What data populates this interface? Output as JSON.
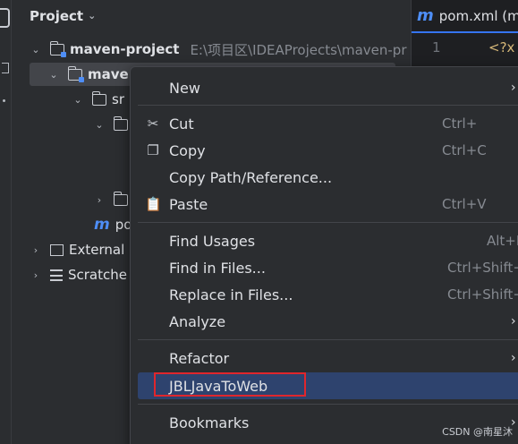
{
  "project_panel": {
    "title": "Project",
    "tree": {
      "root_name": "maven-project",
      "root_path": "E:\\项目区\\IDEAProjects\\maven-pr",
      "module_name": "mave",
      "src": "sr",
      "pom": "po",
      "external": "External",
      "scratches": "Scratche"
    }
  },
  "editor": {
    "tab_label": "pom.xml (ma",
    "line_number": "1",
    "code_text": "<?x"
  },
  "context_menu": {
    "items": [
      {
        "label": "New",
        "shortcut": "",
        "submenu": true
      },
      {
        "label": "Cut",
        "shortcut": "Ctrl+",
        "icon": "scissors-icon"
      },
      {
        "label": "Copy",
        "shortcut": "Ctrl+C",
        "icon": "copy-icon"
      },
      {
        "label": "Copy Path/Reference...",
        "shortcut": ""
      },
      {
        "label": "Paste",
        "shortcut": "Ctrl+V",
        "icon": "paste-icon"
      },
      {
        "label": "Find Usages",
        "shortcut": "Alt+F"
      },
      {
        "label": "Find in Files...",
        "shortcut": "Ctrl+Shift+"
      },
      {
        "label": "Replace in Files...",
        "shortcut": "Ctrl+Shift+"
      },
      {
        "label": "Analyze",
        "shortcut": "",
        "submenu": true
      },
      {
        "label": "Refactor",
        "shortcut": "",
        "submenu": true
      },
      {
        "label": "JBLJavaToWeb",
        "shortcut": "",
        "highlighted": true
      },
      {
        "label": "Bookmarks",
        "shortcut": "",
        "submenu": true
      }
    ]
  },
  "watermark": "CSDN @南星沐",
  "colors": {
    "highlight": "#2e436e",
    "annotation_box": "#e0262c",
    "accent": "#3574f0"
  }
}
